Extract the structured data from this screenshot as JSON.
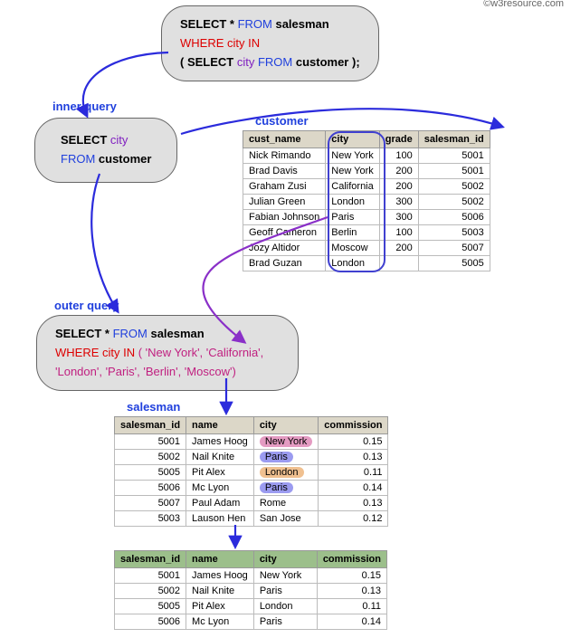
{
  "topQuery": {
    "line1_a": "SELECT * ",
    "line1_b": "FROM",
    "line1_c": " salesman",
    "line2": "WHERE city IN",
    "line3_a": "( SELECT ",
    "line3_b": "city",
    "line3_c": " FROM",
    "line3_d": " customer",
    "line3_e": " );"
  },
  "innerLabel": "inner query ",
  "innerQuery": {
    "line1_a": "SELECT ",
    "line1_b": "city",
    "line2_a": "FROM",
    "line2_b": " customer"
  },
  "outerLabel": "outer query",
  "outerQuery": {
    "line1_a": "SELECT * ",
    "line1_b": "FROM",
    "line1_c": " salesman",
    "line2_a": "WHERE city IN ",
    "line2_b": "( 'New York', 'California', 'London', 'Paris', 'Berlin', 'Moscow')"
  },
  "customerTitle": "customer",
  "customerCols": [
    "cust_name",
    "city",
    "grade",
    "salesman_id"
  ],
  "customerRows": [
    {
      "cust_name": "Nick Rimando",
      "city": "New York",
      "grade": "100",
      "salesman_id": "5001"
    },
    {
      "cust_name": "Brad Davis",
      "city": "New York",
      "grade": "200",
      "salesman_id": "5001"
    },
    {
      "cust_name": "Graham Zusi",
      "city": "California",
      "grade": "200",
      "salesman_id": "5002"
    },
    {
      "cust_name": "Julian Green",
      "city": "London",
      "grade": "300",
      "salesman_id": "5002"
    },
    {
      "cust_name": "Fabian Johnson",
      "city": "Paris",
      "grade": "300",
      "salesman_id": "5006"
    },
    {
      "cust_name": "Geoff Cameron",
      "city": "Berlin",
      "grade": "100",
      "salesman_id": "5003"
    },
    {
      "cust_name": "Jozy Altidor",
      "city": "Moscow",
      "grade": "200",
      "salesman_id": "5007"
    },
    {
      "cust_name": "Brad Guzan",
      "city": "London",
      "grade": "",
      "salesman_id": "5005"
    }
  ],
  "salesmanTitle": "salesman",
  "salesmanCols": [
    "salesman_id",
    "name",
    "city",
    "commission"
  ],
  "salesmanRows": [
    {
      "salesman_id": "5001",
      "name": "James Hoog",
      "city": "New York",
      "commission": "0.15",
      "hl": "pink"
    },
    {
      "salesman_id": "5002",
      "name": "Nail Knite",
      "city": "Paris",
      "commission": "0.13",
      "hl": "blue"
    },
    {
      "salesman_id": "5005",
      "name": "Pit Alex",
      "city": "London",
      "commission": "0.11",
      "hl": "orange"
    },
    {
      "salesman_id": "5006",
      "name": "Mc Lyon",
      "city": "Paris",
      "commission": "0.14",
      "hl": "blue"
    },
    {
      "salesman_id": "5007",
      "name": "Paul Adam",
      "city": "Rome",
      "commission": "0.13",
      "hl": ""
    },
    {
      "salesman_id": "5003",
      "name": "Lauson Hen",
      "city": "San Jose",
      "commission": "0.12",
      "hl": ""
    }
  ],
  "resultCols": [
    "salesman_id",
    "name",
    "city",
    "commission"
  ],
  "resultRows": [
    {
      "salesman_id": "5001",
      "name": "James Hoog",
      "city": "New York",
      "commission": "0.15"
    },
    {
      "salesman_id": "5002",
      "name": "Nail Knite",
      "city": "Paris",
      "commission": "0.13"
    },
    {
      "salesman_id": "5005",
      "name": "Pit Alex",
      "city": "London",
      "commission": "0.11"
    },
    {
      "salesman_id": "5006",
      "name": "Mc Lyon",
      "city": "Paris",
      "commission": "0.14"
    }
  ],
  "credit": "©w3resource.com"
}
